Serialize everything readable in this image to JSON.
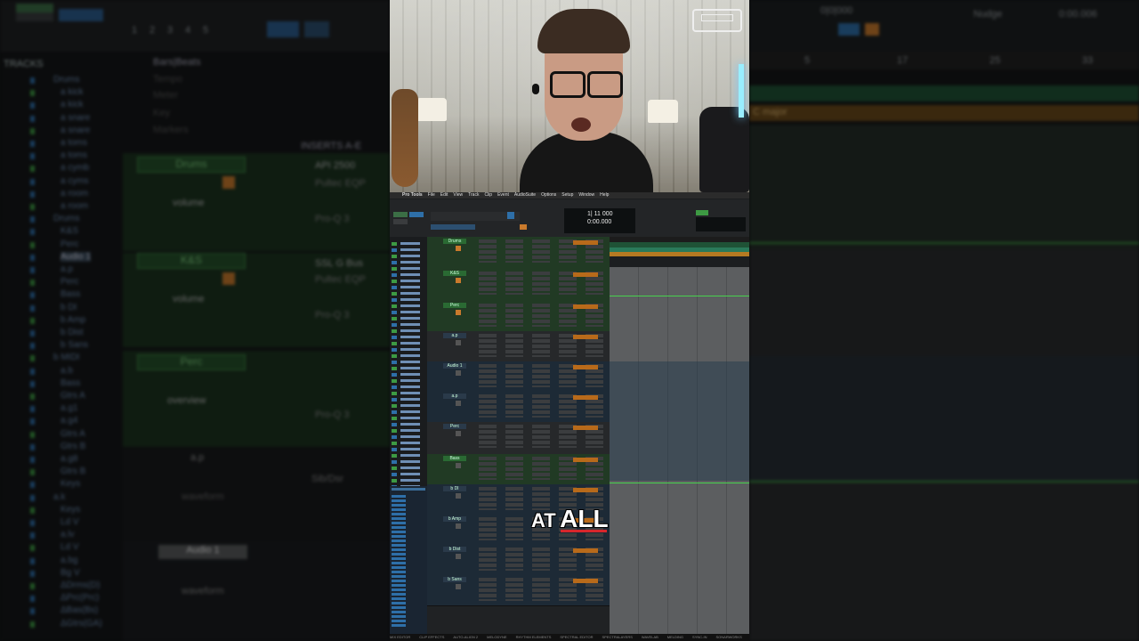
{
  "background_left": {
    "counters": [
      "1",
      "2",
      "3",
      "4",
      "5"
    ],
    "tracks_header": "TRACKS",
    "rulers": [
      "Bars|Beats",
      "Tempo",
      "Meter",
      "Key",
      "Markers"
    ],
    "inserts_header": "INSERTS A-E",
    "track_names": [
      "Drums",
      "a kick",
      "a kick",
      "a snare",
      "a snare",
      "a toms",
      "a toms",
      "a cymb",
      "a cyms",
      "a room",
      "a room",
      "Drums",
      "K&S",
      "Perc",
      "Audio 1",
      "a.p",
      "Perc",
      "Bass",
      "b DI",
      "b Amp",
      "b Dist",
      "b Sans",
      "b MIDI",
      "a.b",
      "Bass",
      "Gtrs A",
      "a.g1",
      "a.g4",
      "Gtrs A",
      "Gtrs B",
      "a.g8",
      "Gtrs B",
      "Keys",
      "a.k",
      "Keys",
      "Ld V",
      "a.lv",
      "Ld V",
      "a.bg",
      "Bg V",
      "ΔDrms(D)",
      "ΔPrc(Prc)",
      "ΔBas(Bs)",
      "ΔGtrs(GA)"
    ],
    "strips": [
      {
        "name": "Drums",
        "view": "volume",
        "insert1": "API 2500",
        "insert2": "Pultec EQP",
        "insert3": "Pro-Q 3"
      },
      {
        "name": "K&S",
        "view": "volume",
        "insert1": "SSL G Bus",
        "insert2": "Pultec EQP",
        "insert3": "Pro-Q 3"
      },
      {
        "name": "Perc",
        "view": "overview",
        "insert1": "",
        "insert2": "",
        "insert3": "Pro-Q 3"
      },
      {
        "name": "a.p",
        "view": "waveform",
        "insert1": "Sib/Dsr",
        "insert2": "",
        "insert3": ""
      },
      {
        "name": "Audio 1",
        "view": "waveform",
        "insert1": "",
        "insert2": "",
        "insert3": ""
      }
    ]
  },
  "background_right": {
    "fields": [
      "0|0|000",
      "Nudge",
      "0:00.006"
    ],
    "ruler_numbers": [
      "5",
      "17",
      "25",
      "33"
    ],
    "key_label": "C major"
  },
  "daw": {
    "app_menu": [
      "Pro Tools",
      "File",
      "Edit",
      "View",
      "Track",
      "Clip",
      "Event",
      "AudioSuite",
      "Options",
      "Setup",
      "Window",
      "Help"
    ],
    "counter_main": "1| 11 000",
    "counter_sub": "0:00.000",
    "visible_tracks": [
      "Drums",
      "K&S",
      "Perc",
      "a.p",
      "Audio 1",
      "a.p",
      "Perc",
      "Bass",
      "b DI",
      "b Amp",
      "b Dist",
      "b Sans"
    ],
    "bottom_bar": [
      "MIX EDITOR",
      "CLIP EFFECTS",
      "AUTO-ALIGN 2",
      "MELODYNE",
      "RHYTHM ELEMENTS",
      "SPECTRAL EDITOR",
      "SPECTRALAYERS",
      "WAVELAB",
      "MELDING",
      "SYNC-IN",
      "SONARWORKS"
    ]
  },
  "caption": {
    "small": "AT",
    "big": "ALL"
  },
  "colors": {
    "green": "#2e7d32",
    "accent_red": "#d8262c",
    "blue": "#2e6fa8"
  }
}
